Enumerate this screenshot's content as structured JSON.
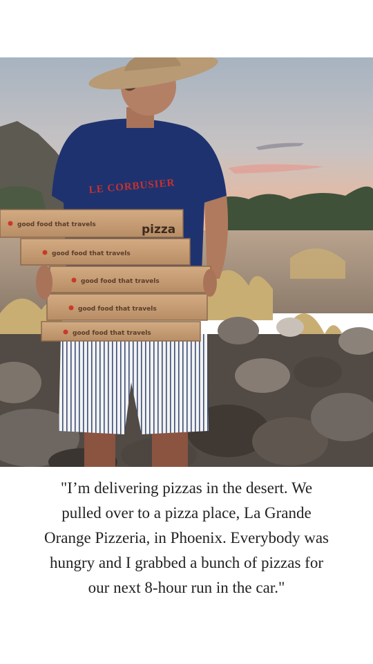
{
  "photo": {
    "shirt_text": "LE CORBUSIER",
    "box_slogan": "good food that travels",
    "box_brand": "pizza",
    "colors": {
      "sky_top": "#a9b4c2",
      "sky_bottom": "#f0b89a",
      "shirt": "#1f3270",
      "box": "#c59b73",
      "shirt_text": "#c8322c",
      "hat": "#b89a74"
    }
  },
  "quote": {
    "lines": [
      "\"I’m delivering pizzas in the desert. We",
      "pulled over to a pizza place, La Grande",
      "Orange Pizzeria, in Phoenix. Everybody was",
      "hungry and I grabbed a bunch of pizzas for",
      "our next 8-hour run in the car.\""
    ]
  }
}
